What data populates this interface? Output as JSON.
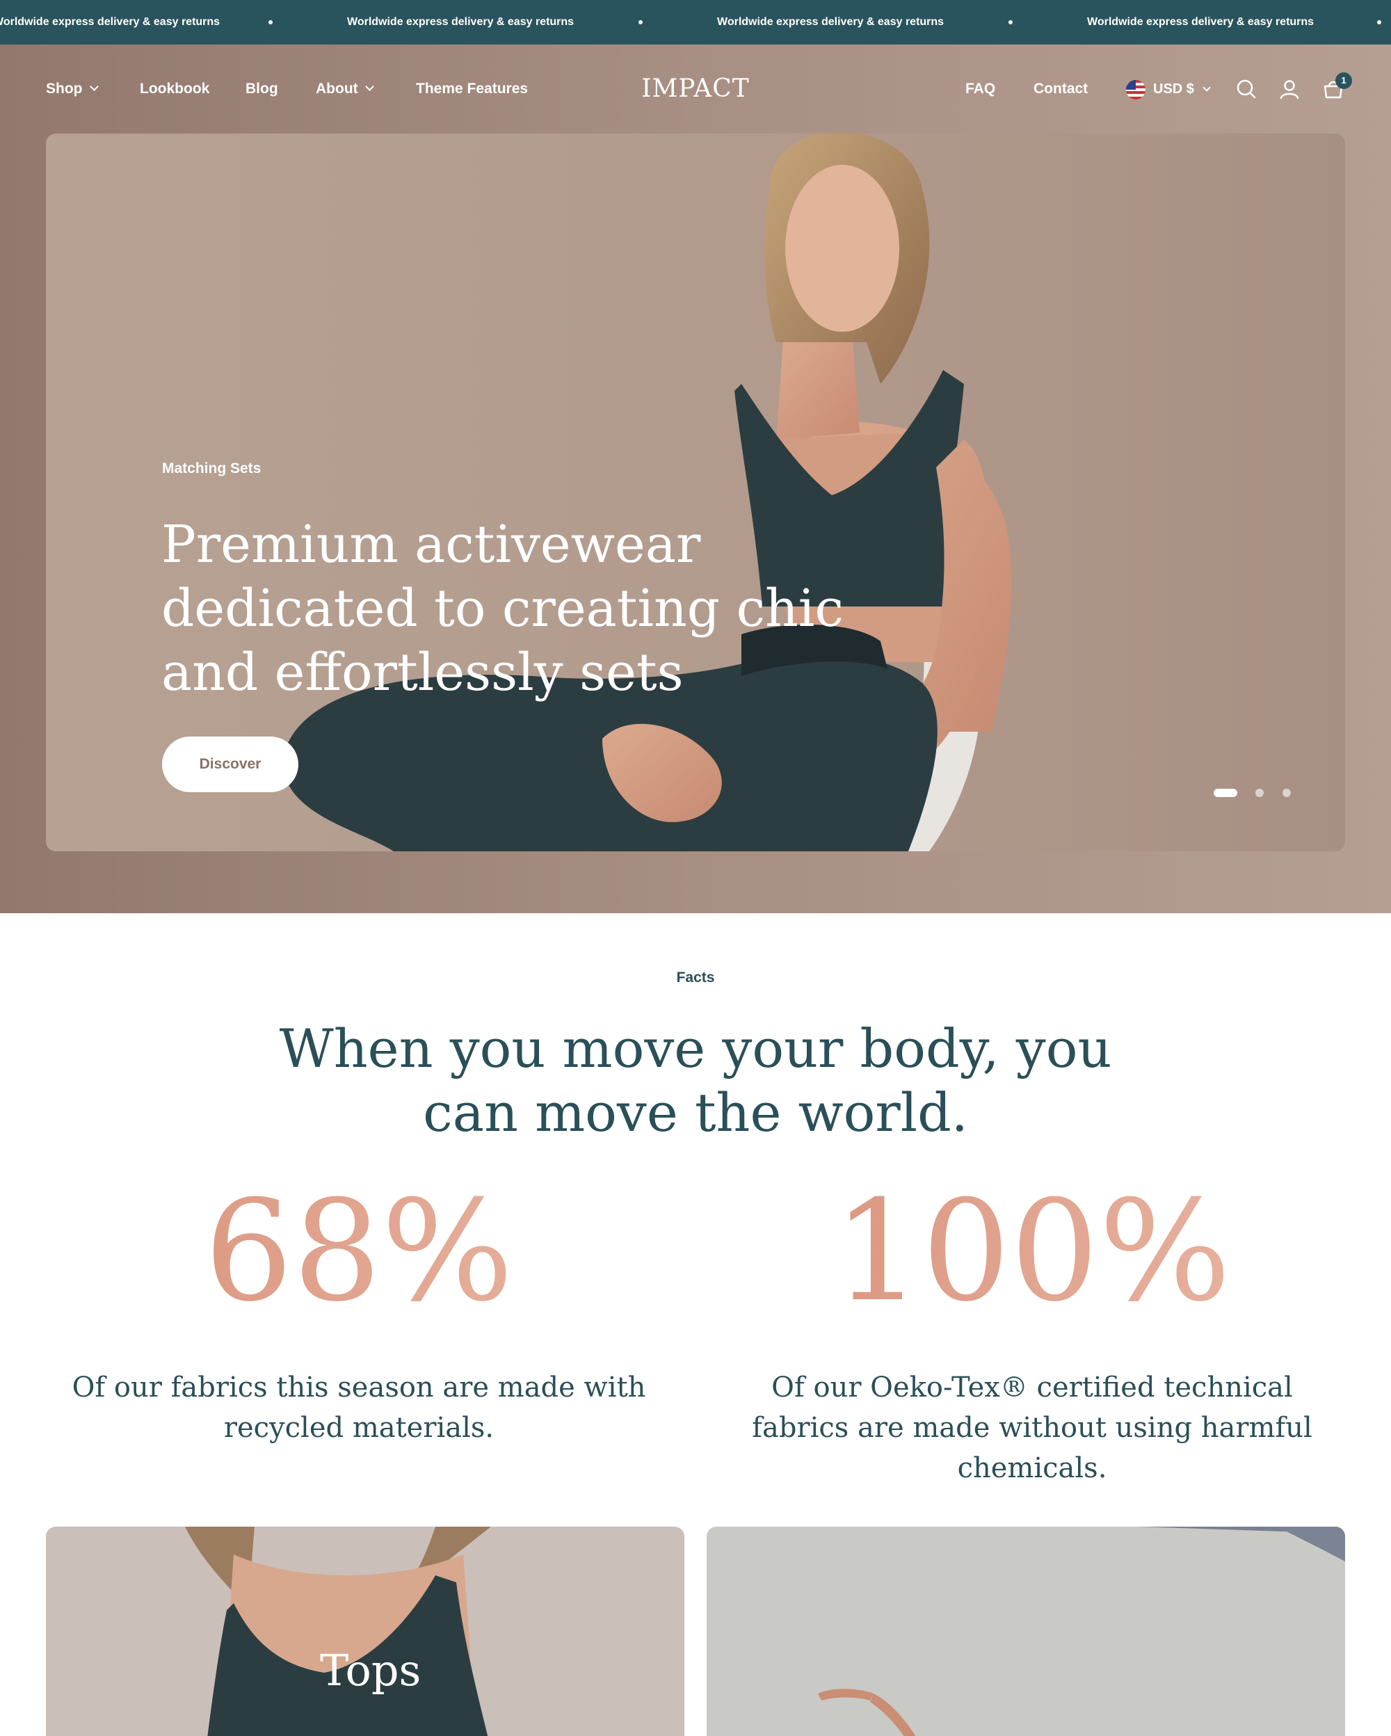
{
  "announcement": {
    "partial_text": "Worldwide express delivery & easy returns",
    "messages": [
      "Worldwide express delivery & easy returns",
      "Worldwide express delivery & easy returns",
      "Worldwide express delivery & easy returns"
    ]
  },
  "header": {
    "nav_left": [
      {
        "label": "Shop",
        "has_dropdown": true
      },
      {
        "label": "Lookbook",
        "has_dropdown": false
      },
      {
        "label": "Blog",
        "has_dropdown": false
      },
      {
        "label": "About",
        "has_dropdown": true
      },
      {
        "label": "Theme Features",
        "has_dropdown": false
      }
    ],
    "logo": "IMPACT",
    "nav_right": [
      {
        "label": "FAQ"
      },
      {
        "label": "Contact"
      }
    ],
    "currency": "USD $",
    "cart_count": "1",
    "icons": [
      "flag-us-icon",
      "chevron-down-icon",
      "search-icon",
      "account-icon",
      "cart-icon"
    ]
  },
  "hero": {
    "eyebrow": "Matching Sets",
    "title": "Premium activewear dedicated to creating chic and effortlessly sets",
    "button_label": "Discover",
    "slide_count": 3,
    "active_slide": 1
  },
  "facts": {
    "eyebrow": "Facts",
    "title": "When you move your body, you can move the world.",
    "stats": [
      {
        "value": "68%",
        "text": "Of our fabrics this season are made with recycled materials."
      },
      {
        "value": "100%",
        "text": "Of our Oeko-Tex® certified technical fabrics are made without using harmful chemicals."
      }
    ]
  },
  "collections": [
    {
      "label": "Tops"
    },
    {
      "label": ""
    }
  ],
  "colors": {
    "announcement_bg": "#2a545d",
    "text_primary": "#2a4f58",
    "accent_gradient_start": "#d9927b",
    "accent_gradient_end": "#e9b7a4",
    "hero_bg": "#a88f83"
  }
}
